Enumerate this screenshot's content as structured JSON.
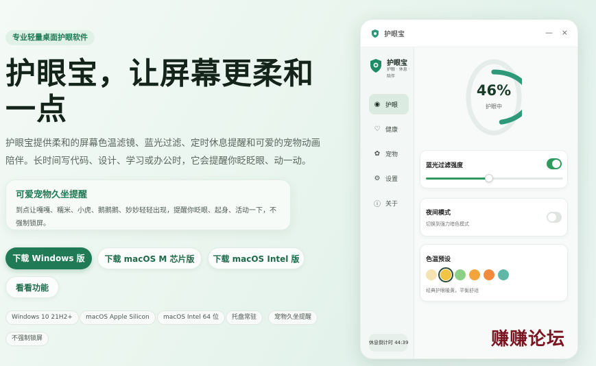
{
  "hero": {
    "badge": "专业轻量桌面护眼软件",
    "title": "护眼宝，让屏幕更柔和一点",
    "description": "护眼宝提供柔和的屏幕色温滤镜、蓝光过滤、定时休息提醒和可爱的宠物动画陪伴。长时间写代码、设计、学习或办公时，它会提醒你眨眨眼、动一动。"
  },
  "feature_card": {
    "title": "可爱宠物久坐提醒",
    "text": "到点让嘎嘎、糯米、小虎、鹅鹅鹅、妙妙轻轻出现，提醒你眨眼、起身、活动一下，不强制锁屏。"
  },
  "buttons": {
    "download_windows": "下载 Windows 版",
    "download_mac_m": "下载 macOS M 芯片版",
    "download_mac_intel": "下载 macOS Intel 版",
    "view_features": "看看功能"
  },
  "chips": [
    "Windows 10 21H2+",
    "macOS Apple Silicon",
    "macOS Intel 64 位",
    "托盘常驻",
    "宠物久坐提醒",
    "不强制锁屏"
  ],
  "app": {
    "window_title": "护眼宝",
    "brand_name": "护眼宝",
    "brand_sub": "护眼 · 休息 · 陪伴",
    "nav": [
      {
        "label": "护眼",
        "icon": "eye-icon",
        "glyph": "◉"
      },
      {
        "label": "健康",
        "icon": "heart-icon",
        "glyph": "♡"
      },
      {
        "label": "宠物",
        "icon": "pet-icon",
        "glyph": "✿"
      },
      {
        "label": "设置",
        "icon": "gear-icon",
        "glyph": "⚙"
      },
      {
        "label": "关于",
        "icon": "info-icon",
        "glyph": "ⓘ"
      }
    ],
    "timer": "休息倒计时 44:39",
    "progress": {
      "value_text": "46%",
      "value": 0.46,
      "label": "护眼中"
    },
    "blue_filter": {
      "title": "蓝光过滤强度",
      "enabled": true,
      "level": 0.46
    },
    "night_mode": {
      "title": "夜间模式",
      "subtitle": "切换到强力暗色模式",
      "enabled": false
    },
    "color_preset": {
      "title": "色温预设",
      "subtitle": "经典护眼暖黄，平衡舒适",
      "swatches": [
        "#f6e3b2",
        "#f2c443",
        "#8ccf86",
        "#f4a43c",
        "#f18a3c",
        "#5fb8a5"
      ],
      "selected_index": 1
    },
    "colors": {
      "accent": "#1f7a55",
      "ring": "#2e9a7a"
    }
  },
  "watermark": "赚赚论坛"
}
